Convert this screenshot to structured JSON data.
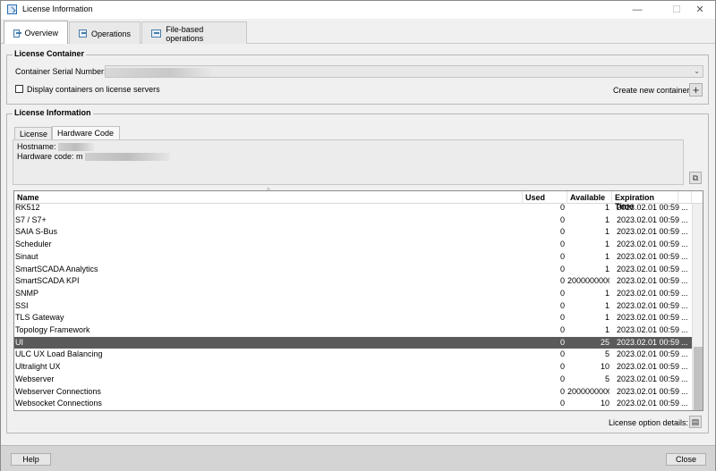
{
  "window": {
    "title": "License Information",
    "minimize": "—",
    "maximize": "☐",
    "close": "✕"
  },
  "tabs": [
    {
      "label": "Overview",
      "icon": "overview-icon"
    },
    {
      "label": "Operations",
      "icon": "operations-icon"
    },
    {
      "label": "File-based operations",
      "icon": "file-operations-icon"
    }
  ],
  "container": {
    "group_title": "License Container",
    "serial_label": "Container Serial Number:",
    "serial_value": "",
    "display_servers_label": "Display containers on license servers",
    "display_servers_checked": false,
    "create_label": "Create new container:",
    "create_icon": "plus-icon"
  },
  "license_info": {
    "group_title": "License Information",
    "subtabs": [
      "License",
      "Hardware Code"
    ],
    "active_subtab": "Hardware Code",
    "hostname_label": "Hostname:",
    "hardware_code_label": "Hardware code: m",
    "copy_icon": "copy-icon",
    "sort_indicator": "^"
  },
  "table": {
    "columns": [
      "Name",
      "Used",
      "Available",
      "Expiration Time",
      ""
    ],
    "rows": [
      {
        "name": "RK512",
        "used": "0",
        "available": "1",
        "expiration": "2023.02.01 00:59",
        "more": "..."
      },
      {
        "name": "S7 / S7+",
        "used": "0",
        "available": "1",
        "expiration": "2023.02.01 00:59",
        "more": "..."
      },
      {
        "name": "SAIA S-Bus",
        "used": "0",
        "available": "1",
        "expiration": "2023.02.01 00:59",
        "more": "..."
      },
      {
        "name": "Scheduler",
        "used": "0",
        "available": "1",
        "expiration": "2023.02.01 00:59",
        "more": "..."
      },
      {
        "name": "Sinaut",
        "used": "0",
        "available": "1",
        "expiration": "2023.02.01 00:59",
        "more": "..."
      },
      {
        "name": "SmartSCADA Analytics",
        "used": "0",
        "available": "1",
        "expiration": "2023.02.01 00:59",
        "more": "..."
      },
      {
        "name": "SmartSCADA KPI",
        "used": "0",
        "available": "2000000000",
        "expiration": "2023.02.01 00:59",
        "more": "..."
      },
      {
        "name": "SNMP",
        "used": "0",
        "available": "1",
        "expiration": "2023.02.01 00:59",
        "more": "..."
      },
      {
        "name": "SSI",
        "used": "0",
        "available": "1",
        "expiration": "2023.02.01 00:59",
        "more": "..."
      },
      {
        "name": "TLS Gateway",
        "used": "0",
        "available": "1",
        "expiration": "2023.02.01 00:59",
        "more": "..."
      },
      {
        "name": "Topology Framework",
        "used": "0",
        "available": "1",
        "expiration": "2023.02.01 00:59",
        "more": "..."
      },
      {
        "name": "UI",
        "used": "0",
        "available": "25",
        "expiration": "2023.02.01 00:59",
        "more": "...",
        "selected": true
      },
      {
        "name": "ULC UX Load Balancing",
        "used": "0",
        "available": "5",
        "expiration": "2023.02.01 00:59",
        "more": "..."
      },
      {
        "name": "Ultralight UX",
        "used": "0",
        "available": "10",
        "expiration": "2023.02.01 00:59",
        "more": "..."
      },
      {
        "name": "Webserver",
        "used": "0",
        "available": "5",
        "expiration": "2023.02.01 00:59",
        "more": "..."
      },
      {
        "name": "Webserver Connections",
        "used": "0",
        "available": "2000000000",
        "expiration": "2023.02.01 00:59",
        "more": "..."
      },
      {
        "name": "Websocket Connections",
        "used": "0",
        "available": "10",
        "expiration": "2023.02.01 00:59",
        "more": "..."
      }
    ]
  },
  "option_details": {
    "label": "License option details:",
    "icon": "details-icon"
  },
  "footer": {
    "help_label": "Help",
    "close_label": "Close"
  }
}
